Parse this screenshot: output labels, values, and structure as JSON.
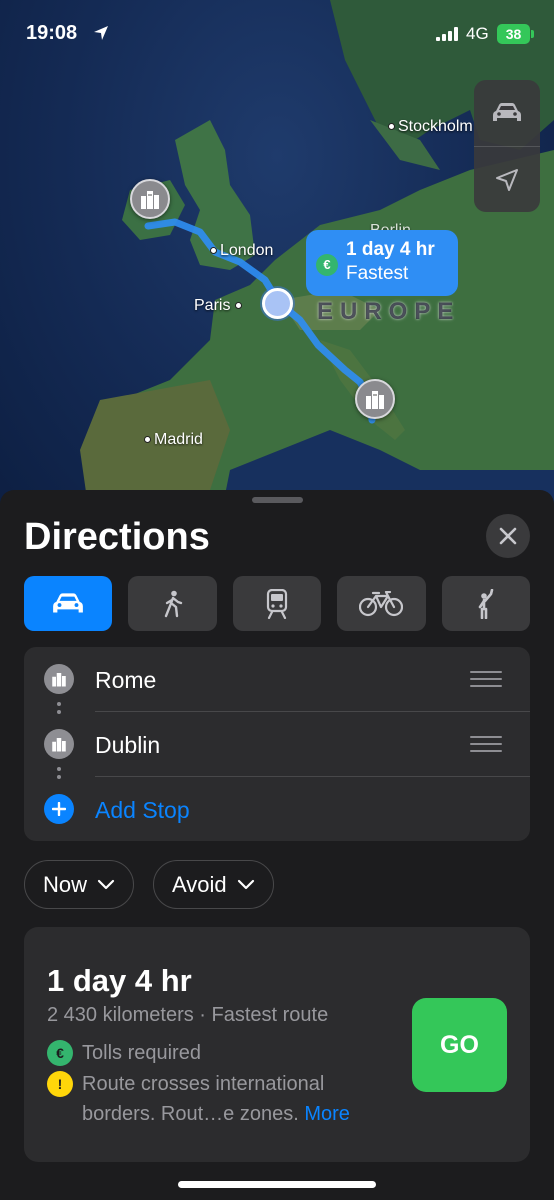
{
  "status_bar": {
    "time": "19:08",
    "network": "4G",
    "battery": "38"
  },
  "map": {
    "cities": [
      "Stockholm",
      "Berlin",
      "London",
      "Paris",
      "Madrid"
    ],
    "region_label": "EUROPE",
    "route_callout": {
      "duration": "1 day 4 hr",
      "label": "Fastest",
      "icon": "euro-icon"
    },
    "controls": {
      "mode_icon": "car-icon",
      "location_icon": "location-arrow-icon"
    },
    "route_color": "#2f8ef4"
  },
  "sheet": {
    "title": "Directions",
    "transport_modes": [
      {
        "name": "Drive",
        "icon": "car-icon",
        "active": true
      },
      {
        "name": "Walk",
        "icon": "walk-icon",
        "active": false
      },
      {
        "name": "Transit",
        "icon": "train-icon",
        "active": false
      },
      {
        "name": "Cycle",
        "icon": "bicycle-icon",
        "active": false
      },
      {
        "name": "Ride",
        "icon": "hail-icon",
        "active": false
      }
    ],
    "stops": [
      {
        "label": "Rome",
        "icon": "landmark-icon"
      },
      {
        "label": "Dublin",
        "icon": "landmark-icon"
      }
    ],
    "add_stop": "Add Stop",
    "filters": {
      "time": "Now",
      "avoid": "Avoid"
    },
    "route": {
      "duration": "1 day 4 hr",
      "summary": "2 430 kilometers · Fastest route",
      "tolls": "Tolls required",
      "border_note": "Route crosses international borders. Rout…e zones.",
      "more_link": "More",
      "go_label": "GO"
    }
  },
  "colors": {
    "accent": "#0a84ff",
    "go": "#34c759",
    "sheet_bg": "#1c1c1e",
    "card_bg": "#2c2c2e"
  }
}
